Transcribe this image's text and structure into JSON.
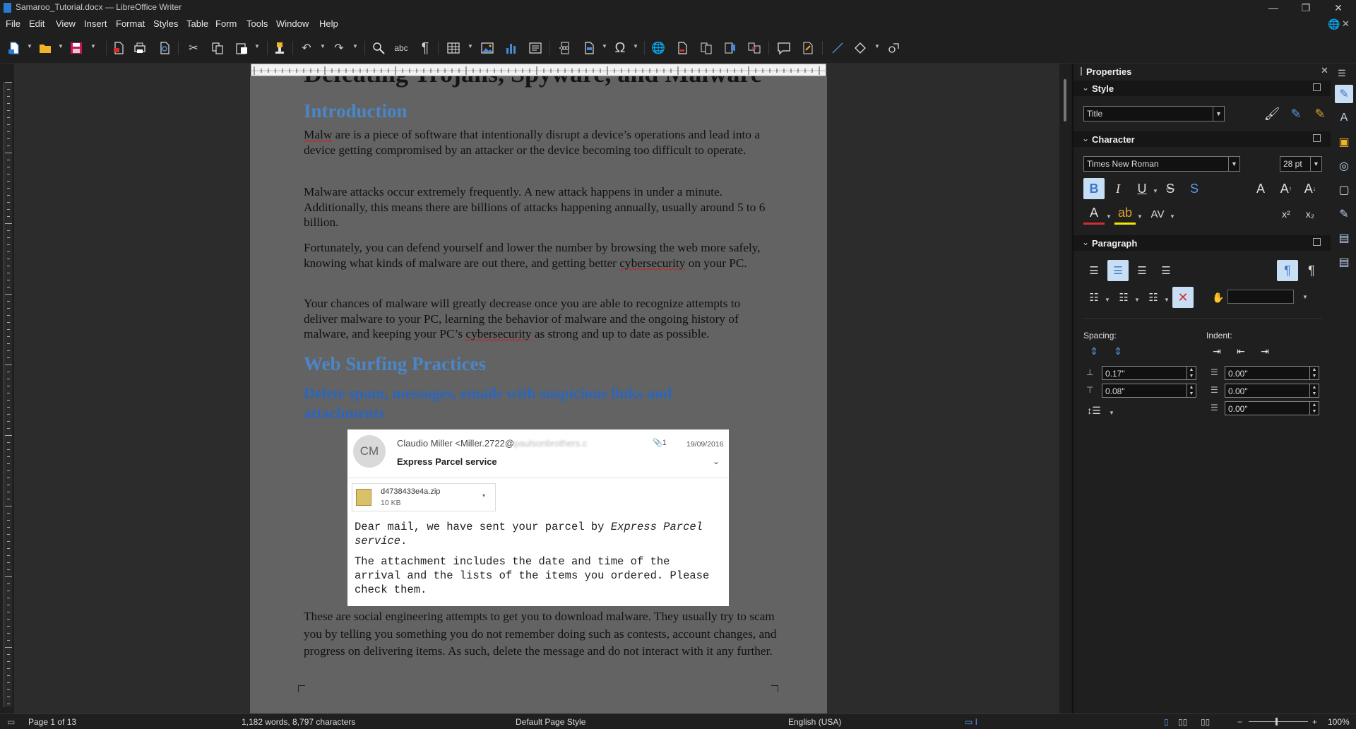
{
  "window": {
    "title": "Samaroo_Tutorial.docx — LibreOffice Writer",
    "minimize": "—",
    "maximize": "❐",
    "close": "✕"
  },
  "menu": [
    "File",
    "Edit",
    "View",
    "Insert",
    "Format",
    "Styles",
    "Table",
    "Form",
    "Tools",
    "Window",
    "Help"
  ],
  "document": {
    "partial_heading": "Defeating Trojans, Spyware, and Malware",
    "heading_intro": "Introduction",
    "p1_malw": "Malw",
    "p1_rest": " are is a piece of software that intentionally disrupt a device’s operations and lead into a device getting compromised by an attacker or the device becoming too difficult to operate.",
    "p2": "Malware attacks occur extremely frequently. A new attack happens in under a minute. Additionally, this means there are billions of attacks happening annually, usually around 5 to 6 billion.",
    "p3_a": "Fortunately, you can defend yourself and lower the number by browsing the web more safely, knowing what kinds of malware are out there, and getting better ",
    "p3_b": "cybersecurity",
    "p3_c": " on your PC.",
    "p4_a": "Your chances of malware will greatly decrease once you are able to recognize attempts to deliver malware to your PC, learning the behavior of malware and the ongoing history of malware, and keeping your PC’s ",
    "p4_b": "cybersecurity",
    "p4_c": " as strong and up to date as possible.",
    "heading_web": "Web Surfing Practices",
    "heading_spam": "Delete spam, messages, emails with suspicious links and attachments",
    "p5": "These are social engineering attempts to get you to download malware. They usually try to scam you by telling you something you do not remember doing such as contests, account changes, and progress on delivering items. As such, delete the message and do not interact with it any further."
  },
  "email": {
    "avatar": "CM",
    "sender": "Claudio Miller <Miller.2722@",
    "sender_blur": "paulsonbrothers.c",
    "attach_count": "1",
    "date": "19/09/2016",
    "subject": "Express Parcel service",
    "file_name": "d4738433e4a.zip",
    "file_size": "10 KB",
    "body1_a": "Dear mail, we have sent your parcel by ",
    "body1_b": "Express Parcel service",
    "body1_c": ".",
    "body2": "The attachment includes the date and time of the arrival and the lists of the items you ordered. Please check them."
  },
  "sidebar": {
    "title": "Properties",
    "style_section": "Style",
    "style_value": "Title",
    "character_section": "Character",
    "font_name": "Times New Roman",
    "font_size": "28 pt",
    "paragraph_section": "Paragraph",
    "spacing_label": "Spacing:",
    "indent_label": "Indent:",
    "above_spacing": "0.17\"",
    "below_spacing": "0.08\"",
    "indent_before": "0.00\"",
    "indent_after": "0.00\"",
    "first_line": "0.00\""
  },
  "status": {
    "page": "Page 1 of 13",
    "words": "1,182 words, 8,797 characters",
    "page_style": "Default Page Style",
    "language": "English (USA)",
    "zoom": "100%"
  },
  "colors": {
    "heading1": "#4a86c8",
    "heading2": "#2a66c0",
    "active_button": "#c8def5"
  }
}
